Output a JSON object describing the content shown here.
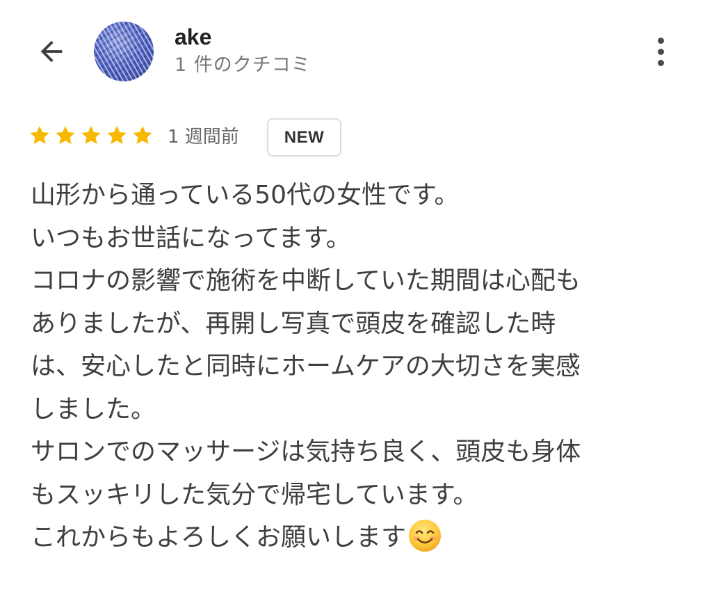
{
  "header": {
    "user_name": "ake",
    "review_count": "1 件のクチコミ"
  },
  "review": {
    "rating": 5,
    "max_rating": 5,
    "time": "1 週間前",
    "badge": "NEW",
    "lines": [
      "山形から通っている50代の女性です。",
      "いつもお世話になってます。",
      "コロナの影響で施術を中断していた期間は心配も",
      "ありましたが、再開し写真で頭皮を確認した時",
      "は、安心したと同時にホームケアの大切さを実感",
      "しました。",
      "サロンでのマッサージは気持ち良く、頭皮も身体",
      "もスッキリした気分で帰宅しています。",
      "これからもよろしくお願いします"
    ],
    "trailing_emoji": "smiling-face-emoji"
  },
  "icons": {
    "back": "arrow-left-icon",
    "more": "more-vertical-icon",
    "star": "star-icon"
  },
  "colors": {
    "star": "#F6B800",
    "text": "#3f3f3f",
    "muted": "#777777"
  }
}
